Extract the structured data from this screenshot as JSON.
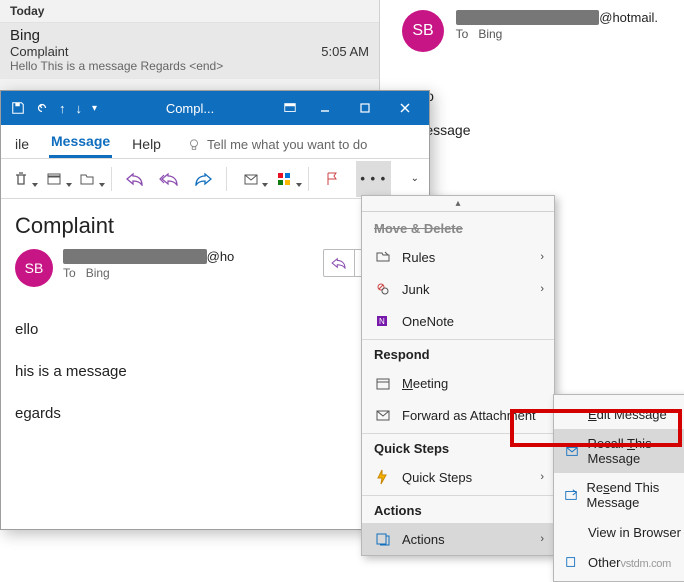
{
  "list": {
    "group": "Today",
    "sender": "Bing",
    "subject": "Complaint",
    "time": "5:05 AM",
    "preview": "Hello  This is a message  Regards <end>"
  },
  "reading": {
    "avatar": "SB",
    "email_domain": "@hotmail.",
    "to_label": "To",
    "to_value": "Bing",
    "body_l1": "Hello",
    "body_l2": "a message"
  },
  "window": {
    "title": "Compl...",
    "tabs": {
      "file": "ile",
      "message": "Message",
      "help": "Help",
      "tell": "Tell me what you want to do"
    },
    "subject": "Complaint",
    "avatar": "SB",
    "from_suffix": "@ho",
    "to_label": "To",
    "to_value": "Bing",
    "body_l1": "ello",
    "body_l2": "his is a message",
    "body_l3": "egards"
  },
  "menu": {
    "header_move": "Move & Delete",
    "rules": "Rules",
    "junk": "Junk",
    "onenote": "OneNote",
    "header_respond": "Respond",
    "meeting": "Meeting",
    "forward_att": "Forward as Attachment",
    "header_quick": "Quick Steps",
    "quick_steps": "Quick Steps",
    "header_actions": "Actions",
    "actions": "Actions"
  },
  "submenu": {
    "edit": "Edit Message",
    "recall_pre": "Recall ",
    "recall_u": "T",
    "recall_post": "his Message",
    "resend": "Resend This Message",
    "view": "View in Browser",
    "other": "Other Actions",
    "watermark_overlay": "vstdm.com"
  }
}
